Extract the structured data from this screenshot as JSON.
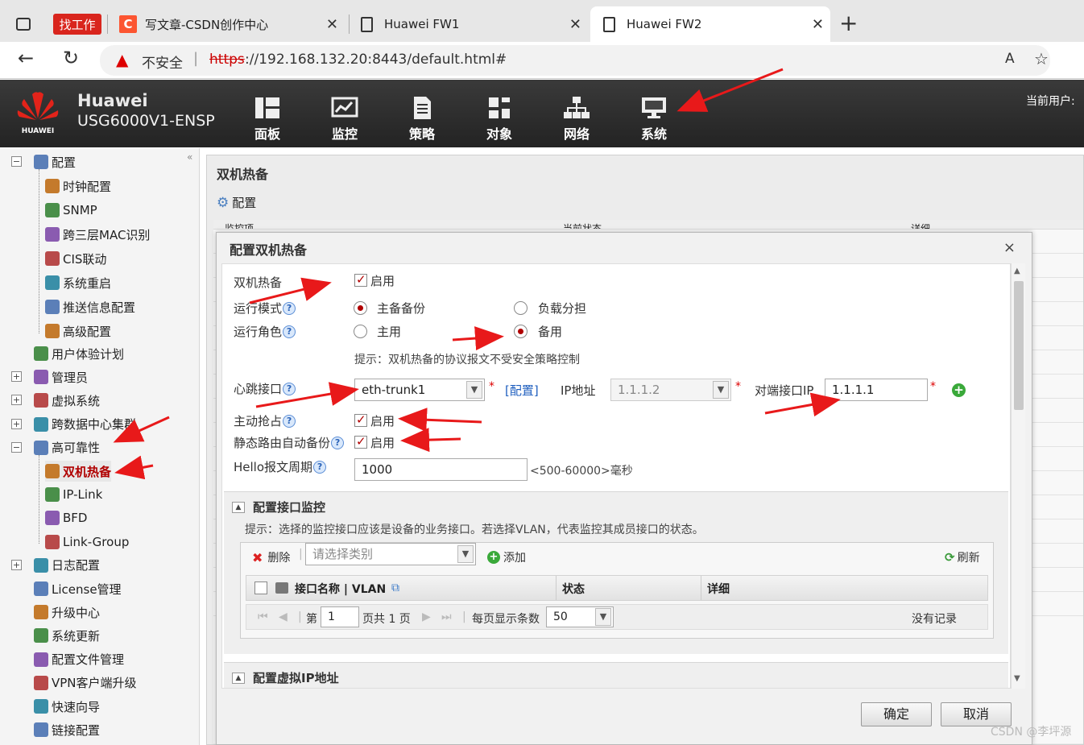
{
  "browser": {
    "tabs": [
      {
        "label": "找工作",
        "kind": "badge"
      },
      {
        "label": "写文章-CSDN创作中心"
      },
      {
        "label": "Huawei FW1"
      },
      {
        "label": "Huawei FW2",
        "active": true
      }
    ],
    "new_tab_label": "+",
    "security_label": "不安全",
    "url_scheme": "https",
    "url_rest": "://192.168.132.20:8443/default.html#",
    "read_aloud_label": "À"
  },
  "header": {
    "brand": "Huawei",
    "model": "USG6000V1-ENSP",
    "logo_text": "HUAWEI",
    "nav": [
      {
        "label": "面板",
        "icon": "dashboard-icon"
      },
      {
        "label": "监控",
        "icon": "monitor-chart-icon"
      },
      {
        "label": "策略",
        "icon": "policy-doc-icon"
      },
      {
        "label": "对象",
        "icon": "object-icon"
      },
      {
        "label": "网络",
        "icon": "network-icon"
      },
      {
        "label": "系统",
        "icon": "system-display-icon"
      }
    ],
    "current_user_label": "当前用户:"
  },
  "sidebar": {
    "items": [
      {
        "label": "配置",
        "level": 0,
        "expander": "-"
      },
      {
        "label": "时钟配置",
        "level": 1
      },
      {
        "label": "SNMP",
        "level": 1
      },
      {
        "label": "跨三层MAC识别",
        "level": 1
      },
      {
        "label": "CIS联动",
        "level": 1
      },
      {
        "label": "系统重启",
        "level": 1
      },
      {
        "label": "推送信息配置",
        "level": 1
      },
      {
        "label": "高级配置",
        "level": 1
      },
      {
        "label": "用户体验计划",
        "level": 0
      },
      {
        "label": "管理员",
        "level": 0,
        "expander": "+"
      },
      {
        "label": "虚拟系统",
        "level": 0,
        "expander": "+"
      },
      {
        "label": "跨数据中心集群",
        "level": 0,
        "expander": "+"
      },
      {
        "label": "高可靠性",
        "level": 0,
        "expander": "-"
      },
      {
        "label": "双机热备",
        "level": 1,
        "selected": true
      },
      {
        "label": "IP-Link",
        "level": 1
      },
      {
        "label": "BFD",
        "level": 1
      },
      {
        "label": "Link-Group",
        "level": 1
      },
      {
        "label": "日志配置",
        "level": 0,
        "expander": "+"
      },
      {
        "label": "License管理",
        "level": 0
      },
      {
        "label": "升级中心",
        "level": 0
      },
      {
        "label": "系统更新",
        "level": 0
      },
      {
        "label": "配置文件管理",
        "level": 0
      },
      {
        "label": "VPN客户端升级",
        "level": 0
      },
      {
        "label": "快速向导",
        "level": 0
      },
      {
        "label": "链接配置",
        "level": 0
      }
    ]
  },
  "main": {
    "title": "双机热备",
    "config_link": "配置"
  },
  "dialog": {
    "title": "配置双机热备",
    "close_label": "×",
    "hrp_label": "双机热备",
    "hrp_enable_label": "启用",
    "hrp_enabled": true,
    "run_mode_label": "运行模式",
    "run_mode_options": [
      "主备备份",
      "负载分担"
    ],
    "run_mode_selected": "主备备份",
    "run_role_label": "运行角色",
    "run_role_options": [
      "主用",
      "备用"
    ],
    "run_role_selected": "备用",
    "hint_text": "提示：双机热备的协议报文不受安全策略控制",
    "heartbeat_label": "心跳接口",
    "heartbeat_value": "eth-trunk1",
    "heartbeat_config_link": "[配置]",
    "ip_label": "IP地址",
    "ip_value": "1.1.1.2",
    "peer_ip_label": "对端接口IP",
    "peer_ip_value": "1.1.1.1",
    "preempt_label": "主动抢占",
    "preempt_enable_label": "启用",
    "preempt_enabled": true,
    "static_route_label": "静态路由自动备份",
    "static_route_enable_label": "启用",
    "static_route_enabled": true,
    "hello_label": "Hello报文周期",
    "hello_value": "1000",
    "hello_range": "<500-60000>毫秒",
    "help_glyph": "?",
    "required_mark": "*",
    "monitor_section": {
      "title": "配置接口监控",
      "hint": "提示：选择的监控接口应该是设备的业务接口。若选择VLAN，代表监控其成员接口的状态。",
      "delete_label": "删除",
      "category_placeholder": "请选择类别",
      "add_label": "添加",
      "refresh_label": "刷新",
      "columns": [
        "接口名称 | VLAN",
        "状态",
        "详细"
      ],
      "pager": {
        "page_prefix": "第",
        "page_value": "1",
        "page_suffix": "页共 1 页",
        "page_size_label": "每页显示条数",
        "page_size_value": "50",
        "empty_text": "没有记录"
      }
    },
    "vip_section": {
      "title": "配置虚拟IP地址"
    },
    "ok_label": "确定",
    "cancel_label": "取消"
  },
  "background_grid_headers": [
    "监控项",
    "当前状态",
    "详细"
  ],
  "watermark": "CSDN @李坪源",
  "colors": {
    "header_bg": "#2c2c2c",
    "selected_text": "#b00000",
    "annotation_arrow": "#e8191a",
    "link_blue": "#1f5fbf"
  }
}
